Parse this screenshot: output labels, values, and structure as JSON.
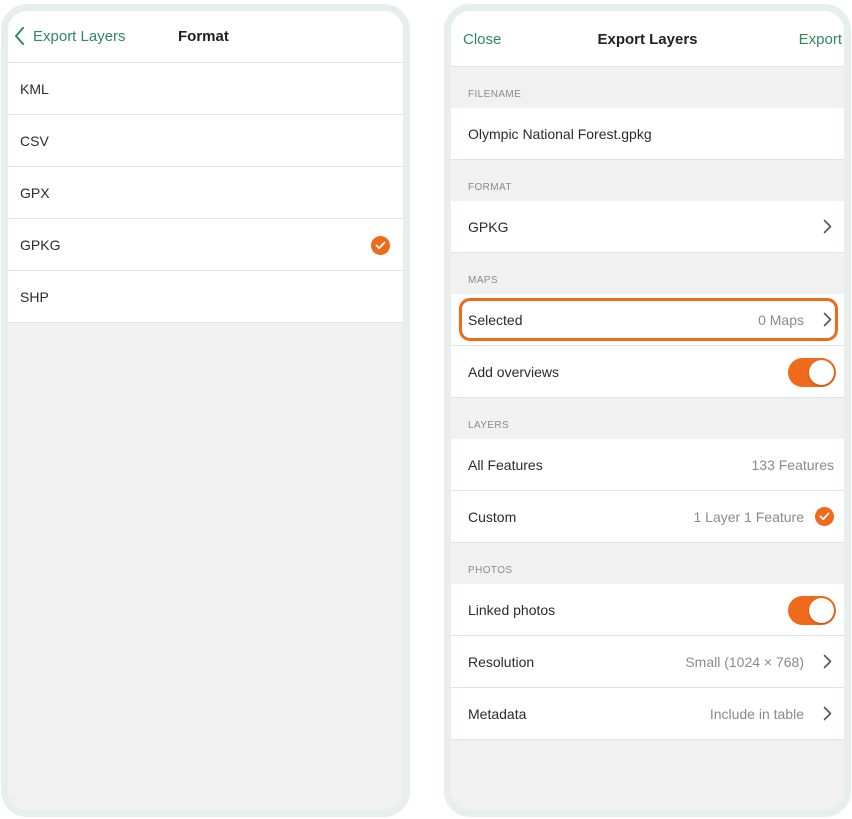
{
  "format_screen": {
    "back_label": "Export Layers",
    "title": "Format",
    "options": [
      {
        "label": "KML",
        "selected": false
      },
      {
        "label": "CSV",
        "selected": false
      },
      {
        "label": "GPX",
        "selected": false
      },
      {
        "label": "GPKG",
        "selected": true
      },
      {
        "label": "SHP",
        "selected": false
      }
    ]
  },
  "export_screen": {
    "close_label": "Close",
    "title": "Export Layers",
    "export_label": "Export",
    "filename": {
      "header": "FILENAME",
      "value": "Olympic National Forest.gpkg"
    },
    "format": {
      "header": "FORMAT",
      "value": "GPKG"
    },
    "maps": {
      "header": "MAPS",
      "selected_label": "Selected",
      "selected_value": "0 Maps",
      "overviews_label": "Add overviews",
      "overviews_on": true
    },
    "layers": {
      "header": "LAYERS",
      "all_label": "All Features",
      "all_value": "133 Features",
      "custom_label": "Custom",
      "custom_value": "1 Layer 1 Feature",
      "custom_selected": true
    },
    "photos": {
      "header": "PHOTOS",
      "linked_label": "Linked photos",
      "linked_on": true,
      "resolution_label": "Resolution",
      "resolution_value": "Small (1024 × 768)",
      "metadata_label": "Metadata",
      "metadata_value": "Include in table"
    }
  },
  "colors": {
    "accent_green": "#2e8a5d",
    "accent_orange": "#ef6a1a",
    "frame": "#e6efec"
  },
  "icons": [
    "chevron-left-icon",
    "chevron-right-icon",
    "checkmark-icon"
  ]
}
